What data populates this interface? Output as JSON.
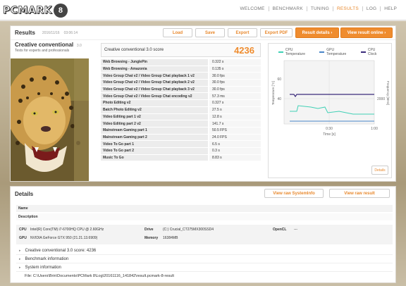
{
  "app": {
    "logo_text": "PCMARK",
    "logo_badge": "8"
  },
  "nav": {
    "items": [
      "WELCOME",
      "BENCHMARK",
      "TUNING",
      "RESULTS",
      "LOG",
      "HELP"
    ],
    "active": "RESULTS"
  },
  "results": {
    "title": "Results",
    "date": "2016/11/16",
    "time": "03:06:14",
    "buttons": {
      "load": "Load",
      "save": "Save",
      "export": "Export",
      "export_pdf": "Export PDF",
      "result_details": "Result details ›",
      "view_online": "View result online ›"
    }
  },
  "benchmark": {
    "name": "Creative conventional",
    "version": "3.0",
    "subtitle": "Tests for experts and professionals"
  },
  "score": {
    "label": "Creative conventional 3.0 score",
    "value": "4236"
  },
  "tests": [
    {
      "name": "Web Browsing - JunglePin",
      "value": "0.322 s"
    },
    {
      "name": "Web Browsing - Amazonia",
      "value": "0.135 s"
    },
    {
      "name": "Video Group Chat v2 / Video Group Chat playback 1 v2",
      "value": "30.0 fps"
    },
    {
      "name": "Video Group Chat v2 / Video Group Chat playback 2 v2",
      "value": "30.0 fps"
    },
    {
      "name": "Video Group Chat v2 / Video Group Chat playback 3 v2",
      "value": "30.0 fps"
    },
    {
      "name": "Video Group Chat v2 / Video Group Chat encoding v2",
      "value": "57.3 ms"
    },
    {
      "name": "Photo Editing v2",
      "value": "0.327 s"
    },
    {
      "name": "Batch Photo Editing v2",
      "value": "27.5 s"
    },
    {
      "name": "Video Editing part 1 v2",
      "value": "12.8 s"
    },
    {
      "name": "Video Editing part 2 v2",
      "value": "141.7 s"
    },
    {
      "name": "Mainstream Gaming part 1",
      "value": "50.5 FPS"
    },
    {
      "name": "Mainstream Gaming part 2",
      "value": "24.0 FPS"
    },
    {
      "name": "Video To Go part 1",
      "value": "6.5 s"
    },
    {
      "name": "Video To Go part 2",
      "value": "0.3 s"
    },
    {
      "name": "Music To Go",
      "value": "8.83 s"
    }
  ],
  "monitor": {
    "legend": [
      "CPU Temperature",
      "GPU Temperature",
      "CPU Clock"
    ],
    "colors": {
      "cpu_temp": "#3fd0b5",
      "gpu_temp": "#4a86c8",
      "cpu_clock": "#3a2a7a"
    },
    "left_axis_label": "Temperature [°C]",
    "right_axis_label": "Frequency [MHz]",
    "x_label": "Time [s]",
    "y_ticks_left": [
      "60",
      "40"
    ],
    "y_ticks_right": [
      "2000"
    ],
    "x_ticks": [
      "0:30",
      "1:00"
    ],
    "details_label": "Details"
  },
  "details": {
    "title": "Details",
    "view_sysinfo": "View raw SystemInfo",
    "view_raw": "View raw result",
    "name_label": "Name",
    "description_label": "Description",
    "cpu_label": "CPU",
    "cpu_value": "Intel(R) Core(TM) i7-6700HQ CPU @ 2.60GHz",
    "gpu_label": "GPU",
    "gpu_value": "NVIDIA GeForce GTX 950 (21.21.13.6909)",
    "drive_label": "Drive",
    "drive_value": "(C:) Crucial_CT275MX300SSD4",
    "memory_label": "Memory",
    "memory_value": "16384MB",
    "opencl_label": "OpenCL",
    "opencl_value": "---",
    "expanders": [
      "Creative conventional 3.0 score: 4236",
      "Benchmark information",
      "System information"
    ],
    "file_path": "File: C:\\Users\\Brin\\Documents\\PCMark 8\\Log\\20161116_141842\\result.pcmark-8-result"
  }
}
